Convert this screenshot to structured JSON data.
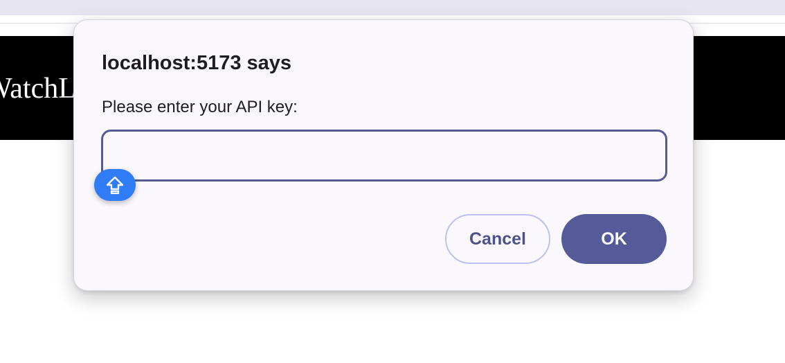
{
  "background_page": {
    "header_title": "WatchList"
  },
  "dialog": {
    "title": "localhost:5173 says",
    "message": "Please enter your API key:",
    "input_value": "",
    "buttons": {
      "cancel_label": "Cancel",
      "ok_label": "OK"
    }
  },
  "caps_lock_indicator": {
    "icon": "caps-lock-icon"
  },
  "colors": {
    "dialog_background": "#fbf8fd",
    "accent": "#545b98",
    "cancel_border": "#bcc1f0",
    "caps_badge": "#2f7cf6"
  }
}
